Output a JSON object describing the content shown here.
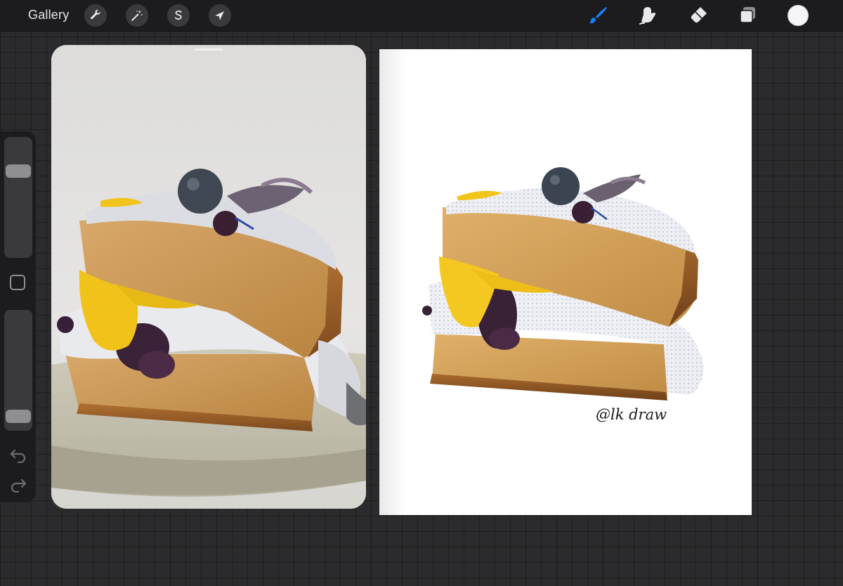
{
  "toolbar": {
    "gallery_label": "Gallery",
    "left_tools": [
      {
        "name": "actions",
        "icon": "wrench-icon"
      },
      {
        "name": "adjustments",
        "icon": "magic-wand-icon"
      },
      {
        "name": "selection",
        "icon": "selection-s-icon"
      },
      {
        "name": "transform",
        "icon": "arrow-cursor-icon"
      }
    ],
    "right_tools": [
      {
        "name": "brush",
        "icon": "brush-icon",
        "active": true
      },
      {
        "name": "smudge",
        "icon": "smudge-icon"
      },
      {
        "name": "eraser",
        "icon": "eraser-icon"
      },
      {
        "name": "layers",
        "icon": "layers-icon"
      }
    ],
    "current_color": "#f5f5f7",
    "active_color": "#1e7cf2"
  },
  "sidebar": {
    "brush_size": 0.76,
    "brush_opacity": 0.05,
    "icons": [
      "modify-square-icon",
      "undo-icon",
      "redo-icon"
    ]
  },
  "reference": {
    "subject": "cake-photo"
  },
  "canvas": {
    "signature": "@lk draw"
  }
}
